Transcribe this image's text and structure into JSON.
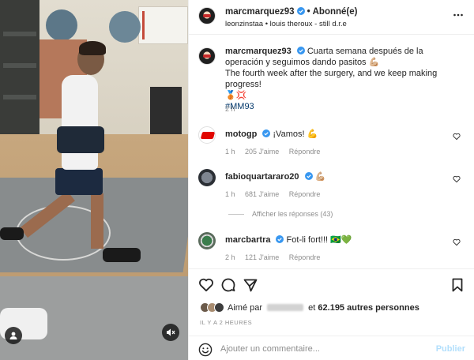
{
  "post": {
    "author": "marcmarquez93",
    "separator": "•",
    "follow_status": "Abonné(e)",
    "audio": "leonzinstaa • louis theroux - still d.r.e",
    "caption_line1": "Cuarta semana después de la operación y seguimos dando pasitos 💪🏼",
    "caption_line2": "The fourth week after the surgery, and we keep making progress!",
    "caption_line3": "🥉💢",
    "caption_tag": "#MM93",
    "caption_time": "2 h"
  },
  "comments": [
    {
      "user": "motogp",
      "text": "¡Vamos! 💪",
      "time": "1 h",
      "likes": "205 J'aime",
      "reply": "Répondre"
    },
    {
      "user": "fabioquartararo20",
      "text": "💪🏼",
      "time": "1 h",
      "likes": "681 J'aime",
      "reply": "Répondre"
    },
    {
      "user": "marcbartra",
      "text": "Fot-li fort!!! 🇧🇷💚",
      "time": "2 h",
      "likes": "121 J'aime",
      "reply": "Répondre"
    }
  ],
  "replies_toggle": "Afficher les réponses (43)",
  "likes": {
    "prefix": "Aimé par",
    "and": "et",
    "count": "62.195 autres personnes"
  },
  "timestamp": "IL Y A 2 HEURES",
  "composer": {
    "placeholder": "Ajouter un commentaire...",
    "publish": "Publier"
  },
  "icons": {
    "more": "more-horizontal-icon",
    "heart": "heart-icon",
    "comment": "comment-icon",
    "share": "share-icon",
    "save": "bookmark-icon",
    "emoji": "emoji-icon",
    "mute": "sound-muted-icon",
    "tagged": "user-icon",
    "verified": "verified-badge-icon"
  },
  "colors": {
    "verified": "#3897f0",
    "muted": "#8e8e8e",
    "publish": "#b2dffc"
  }
}
